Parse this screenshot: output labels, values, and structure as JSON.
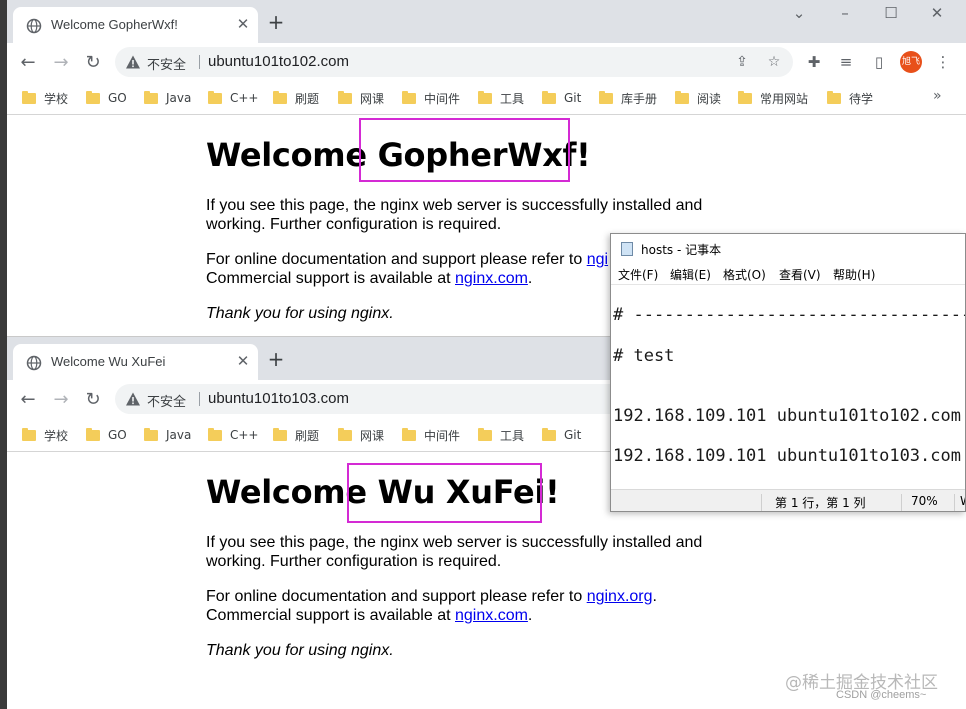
{
  "window_controls": {
    "minimize": "⌄",
    "restore": "–",
    "maximize": "☐",
    "close": "✕"
  },
  "browser1": {
    "tab_title": "Welcome GopherWxf!",
    "insecure_label": "不安全",
    "url": "ubuntu101to102.com",
    "heading": "Welcome GopherWxf!",
    "p1": "If you see this page, the nginx web server is successfully installed and working. Further configuration is required.",
    "p2_prefix": "For online documentation and support please refer to ",
    "p2_link": "ngi",
    "p3_prefix": "Commercial support is available at ",
    "p3_link": "nginx.com",
    "p3_suffix": ".",
    "thanks": "Thank you for using nginx."
  },
  "browser2": {
    "tab_title": "Welcome Wu XuFei",
    "insecure_label": "不安全",
    "url": "ubuntu101to103.com",
    "heading": "Welcome Wu XuFei!",
    "p1": "If you see this page, the nginx web server is successfully installed and working. Further configuration is required.",
    "p2_prefix": "For online documentation and support please refer to ",
    "p2_link": "nginx.org",
    "p2_suffix": ".",
    "p3_prefix": "Commercial support is available at ",
    "p3_link": "nginx.com",
    "p3_suffix": ".",
    "thanks": "Thank you for using nginx."
  },
  "bookmarks": [
    "学校",
    "GO",
    "Java",
    "C++",
    "刷题",
    "网课",
    "中间件",
    "工具",
    "Git",
    "库手册",
    "阅读",
    "常用网站",
    "待学"
  ],
  "bookmarks_more": "»",
  "avatar_text": "旭飞",
  "notepad": {
    "title": "hosts - 记事本",
    "menu": [
      "文件(F)",
      "编辑(E)",
      "格式(O)",
      "查看(V)",
      "帮助(H)"
    ],
    "lines": [
      "# --------------------------------------------------",
      "# test",
      "192.168.109.101 ubuntu101to102.com",
      "192.168.109.101 ubuntu101to103.com"
    ],
    "status_position": "第 1 行，第 1 列",
    "status_zoom": "70%",
    "status_extra": "W"
  },
  "watermark": "@稀土掘金技术社区",
  "credit": "CSDN @cheems~",
  "colors": {
    "highlight_box": "#d42ad4",
    "link": "#0000ee",
    "avatar": "#e8501a",
    "folder": "#f4cd5a"
  }
}
